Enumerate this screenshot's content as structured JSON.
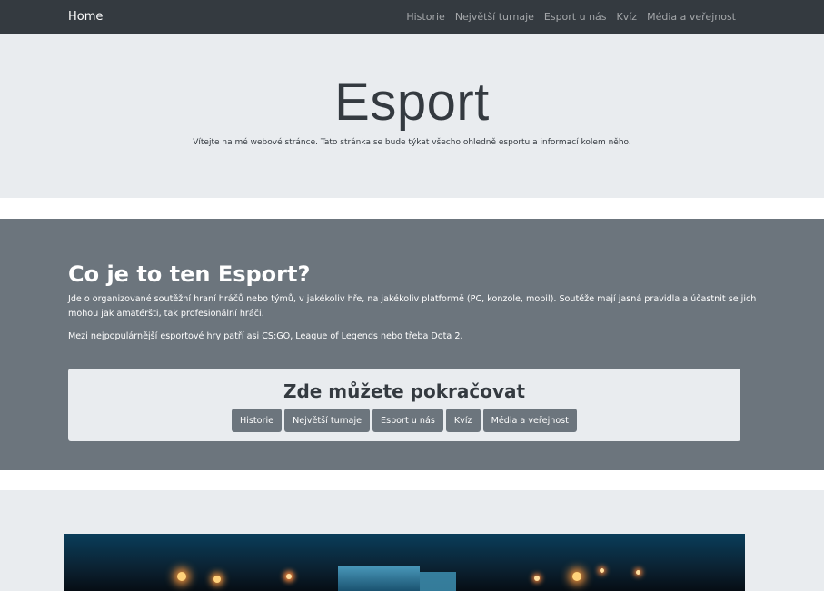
{
  "nav": {
    "brand": "Home",
    "links": [
      "Historie",
      "Největší turnaje",
      "Esport u nás",
      "Kvíz",
      "Média a veřejnost"
    ]
  },
  "hero": {
    "title": "Esport",
    "subtitle": "Vítejte na mé webové stránce. Tato stránka se bude týkat všecho ohledně esportu a informací kolem něho."
  },
  "about": {
    "heading": "Co je to ten Esport?",
    "paragraph1": "Jde o organizované soutěžní hraní hráčů nebo týmů, v jakékoliv hře, na jakékoliv platformě (PC, konzole, mobil). Soutěže mají jasná pravidla a účastnit se jich mohou jak amatéršti, tak profesionální hráči.",
    "paragraph2": "Mezi nejpopulárnější esportové hry patří asi CS:GO, League of Legends nebo třeba Dota 2."
  },
  "continue_card": {
    "heading": "Zde můžete pokračovat",
    "buttons": [
      "Historie",
      "Největší turnaje",
      "Esport u nás",
      "Kvíz",
      "Média a veřejnost"
    ]
  },
  "colors": {
    "navbar": "#343a40",
    "jumbotron": "#e9ecef",
    "about_bg": "#6c757d",
    "button": "#6c757d"
  }
}
